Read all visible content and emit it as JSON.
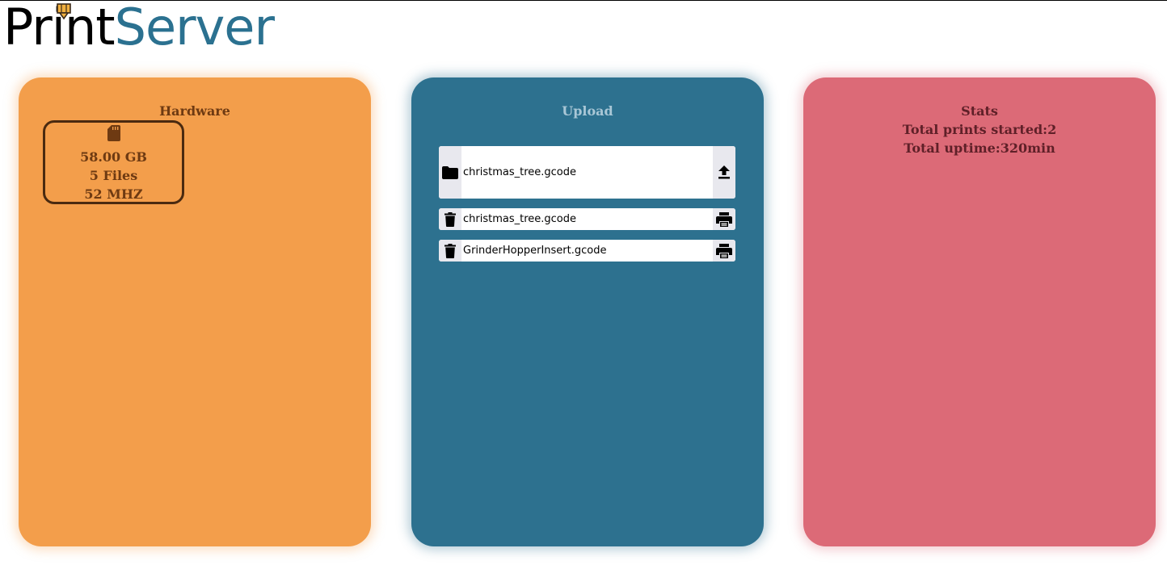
{
  "app": {
    "logo_part_1": "Print",
    "logo_part_2": "Server",
    "logo_icon": "printer-nozzle-icon"
  },
  "colors": {
    "hardware_card": "#f39e4b",
    "upload_card": "#2d718f",
    "stats_card": "#dc6a77",
    "logo_accent": "#2b7190"
  },
  "hardware": {
    "title": "Hardware",
    "sd_card": {
      "icon": "sd-card-icon",
      "size": "58.00 GB",
      "files": "5 Files",
      "speed": "52 MHZ"
    }
  },
  "upload": {
    "title": "Upload",
    "selected_file": {
      "left_icon": "folder-icon",
      "name": "christmas_tree.gcode",
      "right_icon": "upload-icon"
    },
    "files": [
      {
        "left_icon": "trash-icon",
        "name": "christmas_tree.gcode",
        "right_icon": "print-icon"
      },
      {
        "left_icon": "trash-icon",
        "name": "GrinderHopperInsert.gcode",
        "right_icon": "print-icon"
      }
    ]
  },
  "stats": {
    "title": "Stats",
    "prints_started": "Total prints started:2",
    "uptime": "Total uptime:320min"
  }
}
